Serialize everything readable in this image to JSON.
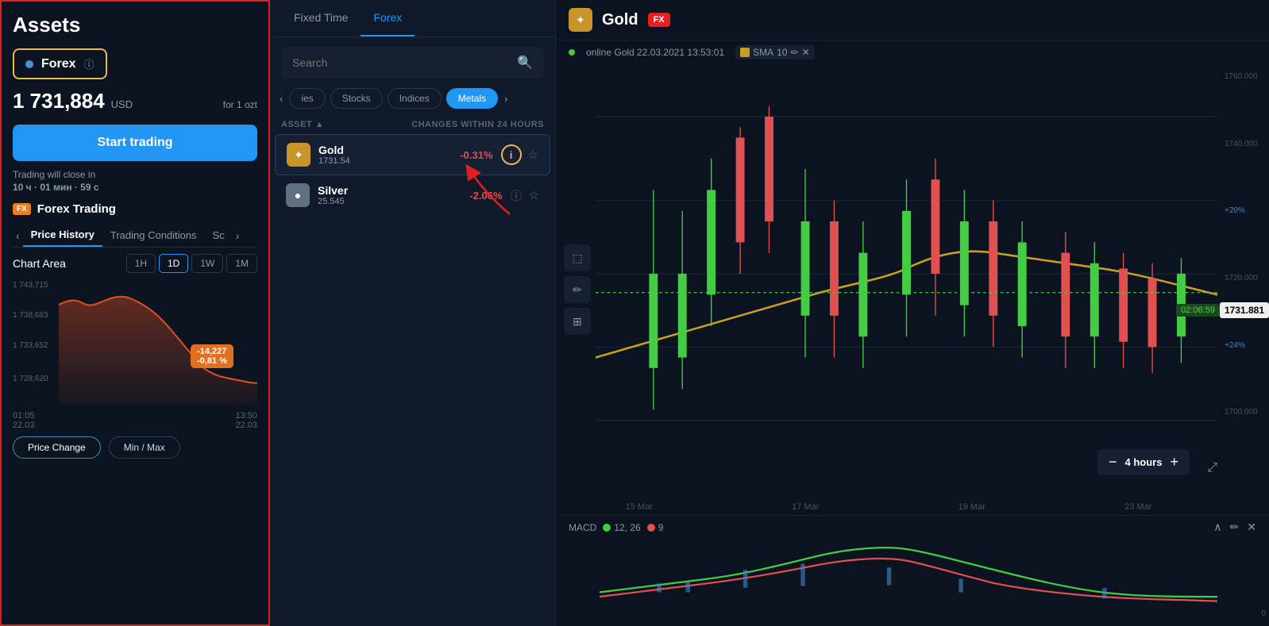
{
  "leftPanel": {
    "title": "Assets",
    "forexBadge": {
      "label": "Forex",
      "infoIcon": "ⓘ"
    },
    "price": {
      "value": "1 731,884",
      "currency": "USD",
      "forLabel": "for 1 ozt"
    },
    "startTradingBtn": "Start trading",
    "tradingClose": {
      "label": "Trading will close in",
      "time": "10 ч · 01 мин · 59 с"
    },
    "forexTrading": {
      "fxBadge": "FX",
      "label": "Forex Trading"
    },
    "tabs": [
      {
        "label": "Price History",
        "active": true
      },
      {
        "label": "Trading Conditions"
      },
      {
        "label": "Sc"
      }
    ],
    "chartArea": {
      "label": "Chart Area",
      "timeBtns": [
        {
          "label": "1H"
        },
        {
          "label": "1D",
          "active": true
        },
        {
          "label": "1W"
        },
        {
          "label": "1M"
        }
      ]
    },
    "chartYLabels": [
      "1 743,715",
      "1 738,683",
      "1 733,652",
      "1 728,620"
    ],
    "chartBadge": {
      "value": "-14,227",
      "pct": "-0,81 %"
    },
    "chartTimes": {
      "start": "01:05\n22.03",
      "end": "13:50\n22.03"
    },
    "bottomBtns": [
      {
        "label": "Price Change",
        "active": true
      },
      {
        "label": "Min / Max"
      }
    ]
  },
  "middlePanel": {
    "tabs": [
      {
        "label": "Fixed Time"
      },
      {
        "label": "Forex",
        "active": true
      }
    ],
    "search": {
      "placeholder": "Search"
    },
    "categories": [
      {
        "label": "ies"
      },
      {
        "label": "Stocks"
      },
      {
        "label": "Indices"
      },
      {
        "label": "Metals",
        "active": true
      }
    ],
    "tableHeader": {
      "asset": "ASSET ▲",
      "changes": "CHANGES WITHIN 24 HOURS"
    },
    "assets": [
      {
        "name": "Gold",
        "price": "1731.54",
        "change": "-0.31%",
        "selected": true,
        "iconColor": "#c8952a",
        "iconSymbol": "🥇"
      },
      {
        "name": "Silver",
        "price": "25.545",
        "change": "-2.06%",
        "selected": false,
        "iconColor": "#607080",
        "iconSymbol": "●"
      }
    ]
  },
  "chartPanel": {
    "title": "Gold",
    "fxBadge": "FX",
    "onlineText": "online Gold 22.03.2021 13:53:01",
    "sma": {
      "label": "SMA",
      "value": "10",
      "editIcon": "✏",
      "closeIcon": "✕"
    },
    "yAxis": [
      "1760.000",
      "1740.000",
      "+20%",
      "1720.000",
      "+24%",
      "1700.000",
      ""
    ],
    "xAxis": [
      "15 Mar",
      "17 Mar",
      "19 Mar",
      "23 Mar"
    ],
    "priceLineTime": "02:06:59",
    "currentPrice": "1731.881",
    "timeControl": {
      "minus": "−",
      "label": "4 hours",
      "plus": "+"
    },
    "macd": {
      "label": "MACD",
      "legend": [
        {
          "color": "#44cc44",
          "label": "12, 26"
        },
        {
          "color": "#e05050",
          "label": "9"
        }
      ]
    }
  }
}
